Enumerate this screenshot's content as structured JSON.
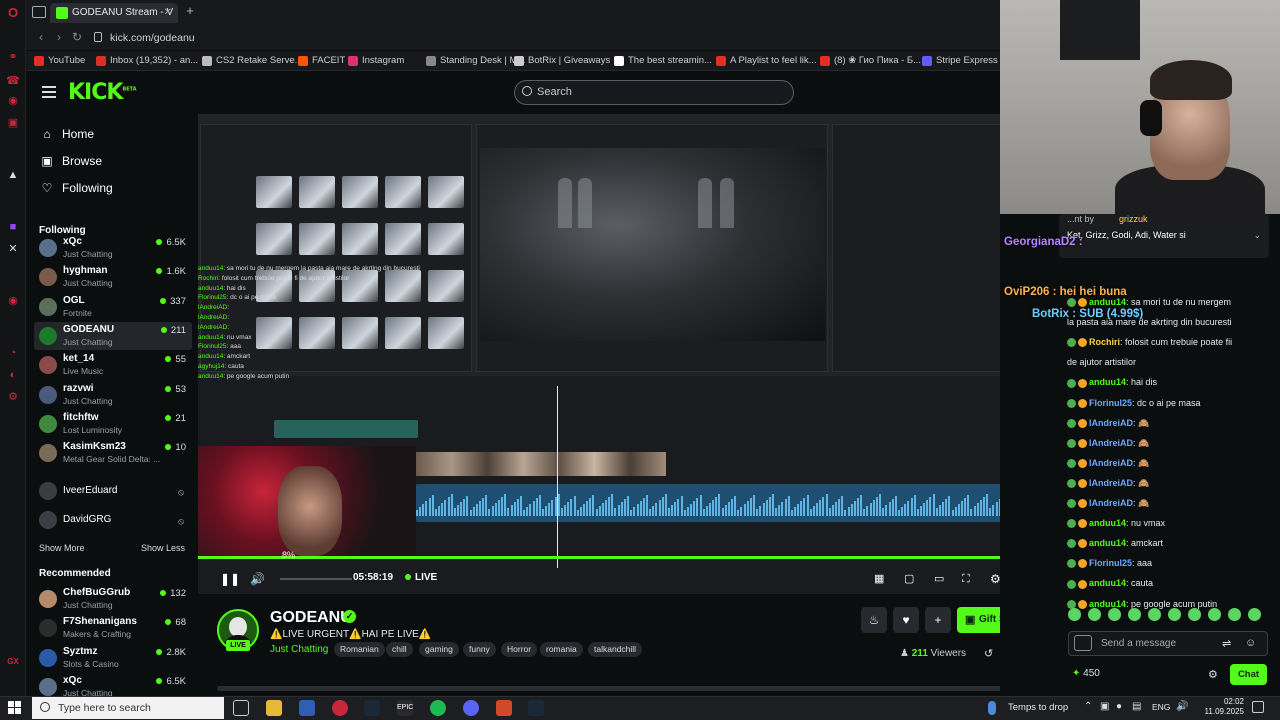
{
  "browser": {
    "tab_title": "GODEANU Stream - V",
    "url": "kick.com/godeanu",
    "bookmarks": [
      {
        "label": "YouTube",
        "color": "#e52d27"
      },
      {
        "label": "Inbox (19,352) - an...",
        "color": "#d93025"
      },
      {
        "label": "CS2 Retake Serve...",
        "color": "#bbbbbb"
      },
      {
        "label": "FACEIT",
        "color": "#ff5500"
      },
      {
        "label": "Instagram",
        "color": "#e1306c"
      },
      {
        "label": "Standing Desk | M...",
        "color": "#888888"
      },
      {
        "label": "BotRix | Giveaways",
        "color": "#cccccc"
      },
      {
        "label": "The best streamin...",
        "color": "#ffffff"
      },
      {
        "label": "A Playlist to feel lik...",
        "color": "#e52d27"
      },
      {
        "label": "(8) ❀ Гио Пика - Б...",
        "color": "#e52d27"
      },
      {
        "label": "Stripe Express",
        "color": "#635bff"
      }
    ]
  },
  "header": {
    "logo": "KICK",
    "logo_beta": "BETA",
    "search_placeholder": "Search"
  },
  "sidebar": {
    "nav": [
      {
        "label": "Home",
        "icon": "home-icon",
        "glyph": "⌂"
      },
      {
        "label": "Browse",
        "icon": "browse-icon",
        "glyph": "▣"
      },
      {
        "label": "Following",
        "icon": "heart-icon",
        "glyph": "♡"
      }
    ],
    "following_title": "Following",
    "following": [
      {
        "name": "xQc",
        "category": "Just Chatting",
        "viewers": "6.5K"
      },
      {
        "name": "hyghman",
        "category": "Just Chatting",
        "viewers": "1.6K"
      },
      {
        "name": "OGL",
        "category": "Fortnite",
        "viewers": "337"
      },
      {
        "name": "GODEANU",
        "category": "Just Chatting",
        "viewers": "211"
      },
      {
        "name": "ket_14",
        "category": "Live Music",
        "viewers": "55"
      },
      {
        "name": "razvwi",
        "category": "Just Chatting",
        "viewers": "53"
      },
      {
        "name": "fitchftw",
        "category": "Lost Luminosity",
        "viewers": "21"
      },
      {
        "name": "KasimKsm23",
        "category": "Metal Gear Solid Delta: ...",
        "viewers": "10"
      }
    ],
    "offline": [
      "IveerEduard",
      "DavidGRG"
    ],
    "show_more": "Show More",
    "show_less": "Show Less",
    "recommended_title": "Recommended",
    "recommended": [
      {
        "name": "ChefBuGGrub",
        "category": "Just Chatting",
        "viewers": "132"
      },
      {
        "name": "F7Shenanigans",
        "category": "Makers & Crafting",
        "viewers": "68"
      },
      {
        "name": "Syztmz",
        "category": "Slots & Casino",
        "viewers": "2.8K"
      },
      {
        "name": "xQc",
        "category": "Just Chatting",
        "viewers": "6.5K"
      }
    ]
  },
  "player": {
    "progress_label": "8%",
    "progress_fraction": 0.08,
    "elapsed": "05:58:19",
    "live_label": "LIVE"
  },
  "overlay_chat": [
    {
      "user": "anduu14",
      "msg": ": sa mori tu de nu mergem la pasta aia mare de akrting din bucuresti"
    },
    {
      "user": "Rochiri",
      "msg": ": folosit cum trebuie poate fi de ajutor artistilor"
    },
    {
      "user": "anduu14",
      "msg": ": hai dis"
    },
    {
      "user": "Florinul25",
      "msg": ": dc o ai pe masa"
    },
    {
      "user": "lAndreiAD",
      "msg": ":"
    },
    {
      "user": "lAndreiAD",
      "msg": ":"
    },
    {
      "user": "lAndreiAD",
      "msg": ":"
    },
    {
      "user": "anduu14",
      "msg": ": nu vmax"
    },
    {
      "user": "Florinul25",
      "msg": ": aaa"
    },
    {
      "user": "anduu14",
      "msg": ": amckart"
    },
    {
      "user": "agyhuj14",
      "msg": ": cauta"
    },
    {
      "user": "anduu14",
      "msg": ": pe google acum putin"
    }
  ],
  "stream": {
    "name": "GODEANU",
    "title": "⚠️LIVE URGENT⚠️HAI PE LIVE⚠️",
    "category": "Just Chatting",
    "tags": [
      "Romanian",
      "chill",
      "gaming",
      "funny",
      "Horror",
      "romania",
      "talkandchill"
    ],
    "viewers": "211",
    "viewers_label": "Viewers",
    "gift_label": "Gift Subs",
    "live_tag": "LIVE"
  },
  "chat": {
    "pinned_line1": "...nt by",
    "pinned_user": "grizzuk",
    "pinned_text": "Ket, Grizz, Godi, Adi, Water si",
    "overlay_big": [
      {
        "text": "OviP206 : hei hei buna",
        "color": "#ffb347"
      },
      {
        "text": "BotRix : SUB (4.99$)",
        "color": "#6fd0ff"
      },
      {
        "text": "GeorgianaD2 :",
        "color": "#b884ff"
      }
    ],
    "messages": [
      {
        "user": "anduu14",
        "text": ": sa mori tu de nu mergem",
        "color": "#53fc18"
      },
      {
        "user": "",
        "text": "la pasta aia mare de akrting din bucuresti",
        "color": "#53fc18"
      },
      {
        "user": "Rochiri",
        "text": ": folosit cum trebuie poate fii",
        "color": "#ffd24a"
      },
      {
        "user": "",
        "text": "de ajutor artistilor",
        "color": "#ffd24a"
      },
      {
        "user": "anduu14",
        "text": ": hai dis",
        "color": "#53fc18"
      },
      {
        "user": "Florinul25",
        "text": ": dc o ai pe masa",
        "color": "#6fa8ff"
      },
      {
        "user": "lAndreiAD",
        "text": ": 🙈",
        "color": "#6fa8ff"
      },
      {
        "user": "lAndreiAD",
        "text": ": 🙈",
        "color": "#6fa8ff"
      },
      {
        "user": "lAndreiAD",
        "text": ": 🙈",
        "color": "#6fa8ff"
      },
      {
        "user": "lAndreiAD",
        "text": ": 🙈",
        "color": "#6fa8ff"
      },
      {
        "user": "lAndreiAD",
        "text": ": 🙈",
        "color": "#6fa8ff"
      },
      {
        "user": "anduu14",
        "text": ": nu vmax",
        "color": "#53fc18"
      },
      {
        "user": "anduu14",
        "text": ": amckart",
        "color": "#53fc18"
      },
      {
        "user": "Florinul25",
        "text": ": aaa",
        "color": "#6fa8ff"
      },
      {
        "user": "anduu14",
        "text": ": cauta",
        "color": "#53fc18"
      },
      {
        "user": "anduu14",
        "text": ": pe google acum putin",
        "color": "#53fc18"
      }
    ],
    "input_placeholder": "Send a message",
    "points": "450",
    "send_label": "Chat"
  },
  "taskbar": {
    "search_placeholder": "Type here to search",
    "weather": "Temps to drop",
    "lang": "ENG",
    "time": "02:02",
    "date": "11.09.2025"
  },
  "colors": {
    "accent": "#53fc18",
    "bg": "#0b0e0f"
  }
}
